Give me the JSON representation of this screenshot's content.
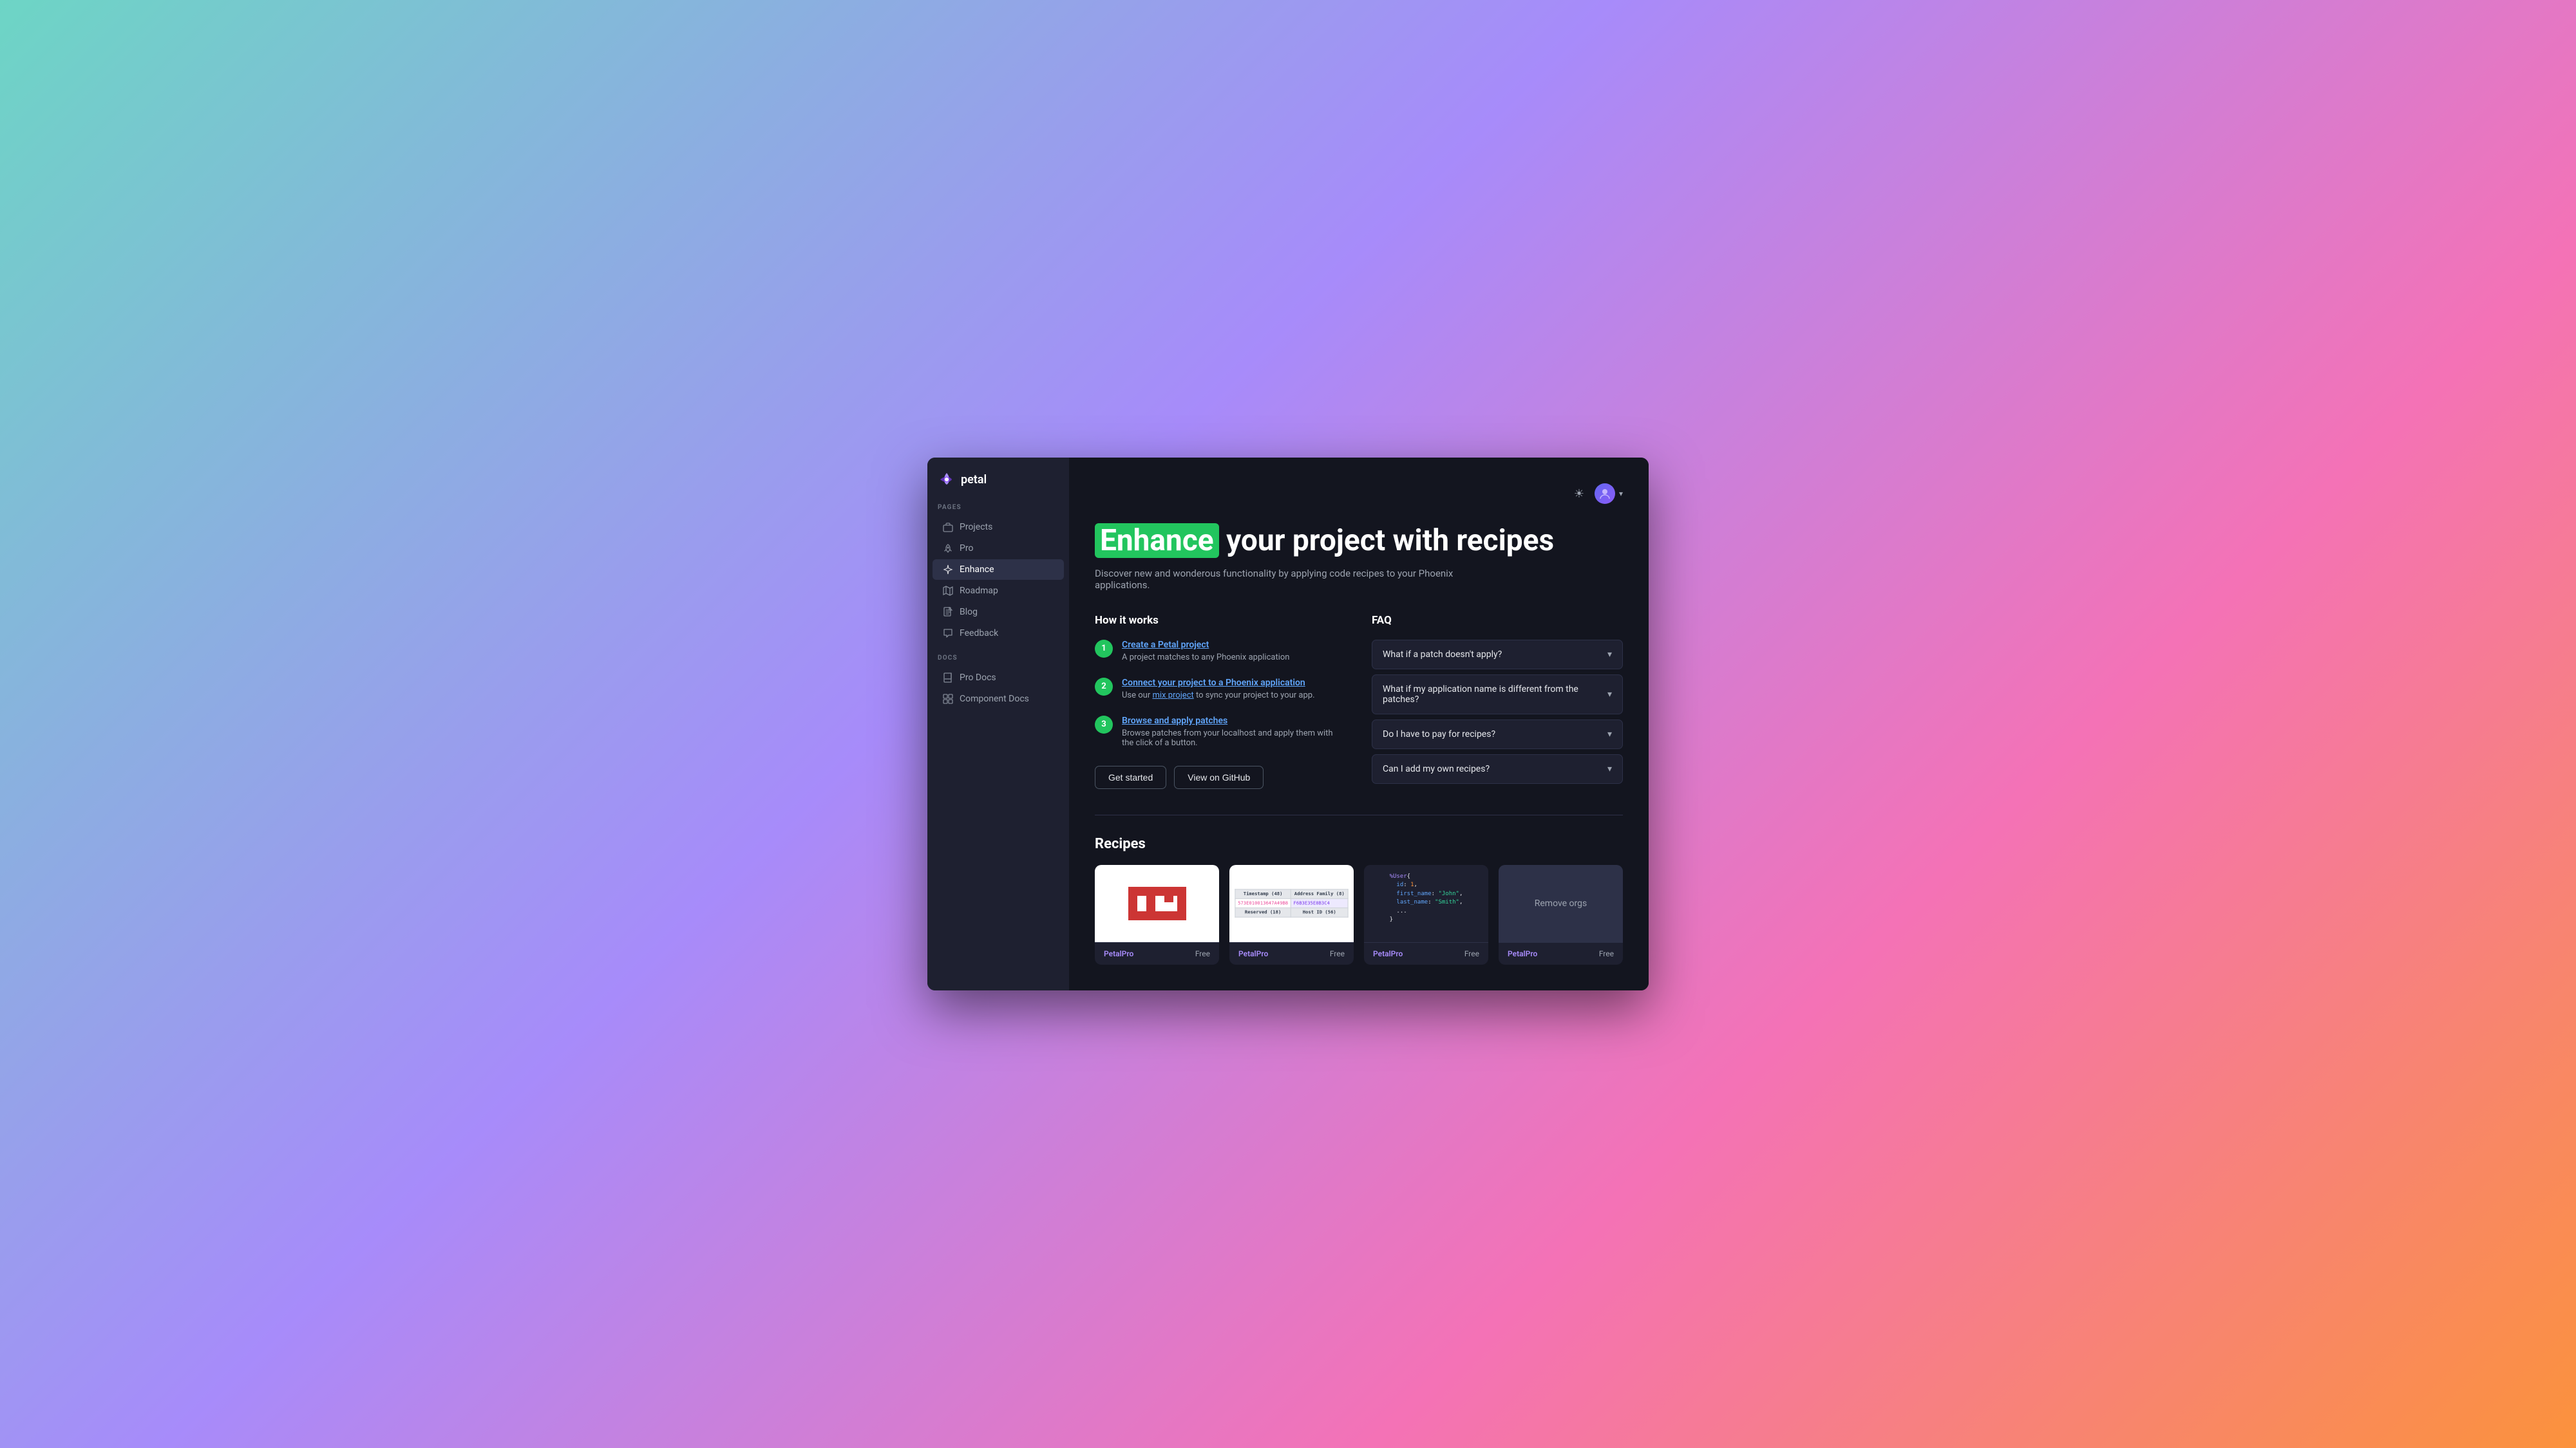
{
  "app": {
    "name": "petal",
    "logo_symbol": "✿"
  },
  "sidebar": {
    "pages_label": "PAGES",
    "docs_label": "DOCS",
    "nav_items": [
      {
        "id": "projects",
        "label": "Projects",
        "icon": "briefcase"
      },
      {
        "id": "pro",
        "label": "Pro",
        "icon": "rocket"
      },
      {
        "id": "enhance",
        "label": "Enhance",
        "icon": "sparkle",
        "active": true
      },
      {
        "id": "roadmap",
        "label": "Roadmap",
        "icon": "map"
      },
      {
        "id": "blog",
        "label": "Blog",
        "icon": "document"
      },
      {
        "id": "feedback",
        "label": "Feedback",
        "icon": "chat"
      }
    ],
    "doc_items": [
      {
        "id": "pro-docs",
        "label": "Pro Docs",
        "icon": "book"
      },
      {
        "id": "component-docs",
        "label": "Component Docs",
        "icon": "grid"
      }
    ]
  },
  "hero": {
    "highlight": "Enhance",
    "title_rest": " your project with recipes",
    "subtitle": "Discover new and wonderous functionality by applying code recipes to your Phoenix applications."
  },
  "how_it_works": {
    "section_title": "How it works",
    "steps": [
      {
        "number": "1",
        "title": "Create a Petal project",
        "title_link": true,
        "description": "A project matches to any Phoenix application"
      },
      {
        "number": "2",
        "title": "Connect your project to a Phoenix application",
        "description_parts": [
          "Use our ",
          "mix project",
          " to sync your project to your app."
        ],
        "has_link": true
      },
      {
        "number": "3",
        "title": "Browse and apply patches",
        "description": "Browse patches from your localhost and apply them with the click of a button."
      }
    ]
  },
  "buttons": {
    "get_started": "Get started",
    "view_github": "View on GitHub"
  },
  "faq": {
    "section_title": "FAQ",
    "items": [
      {
        "question": "What if a patch doesn't apply?"
      },
      {
        "question": "What if my application name is different from the patches?"
      },
      {
        "question": "Do I have to pay for recipes?"
      },
      {
        "question": "Can I add my own recipes?"
      }
    ]
  },
  "recipes": {
    "section_title": "Recipes",
    "cards": [
      {
        "id": "npm",
        "thumbnail_type": "npm",
        "brand": "PetalPro",
        "price": "Free"
      },
      {
        "id": "uuid",
        "thumbnail_type": "uuid",
        "brand": "PetalPro",
        "price": "Free"
      },
      {
        "id": "code",
        "thumbnail_type": "code",
        "brand": "PetalPro",
        "price": "Free"
      },
      {
        "id": "remove-orgs",
        "thumbnail_type": "remove-orgs",
        "label": "Remove orgs",
        "brand": "PetalPro",
        "price": "Free"
      }
    ]
  },
  "topbar": {
    "theme_icon": "☀",
    "user_chevron": "▾"
  }
}
